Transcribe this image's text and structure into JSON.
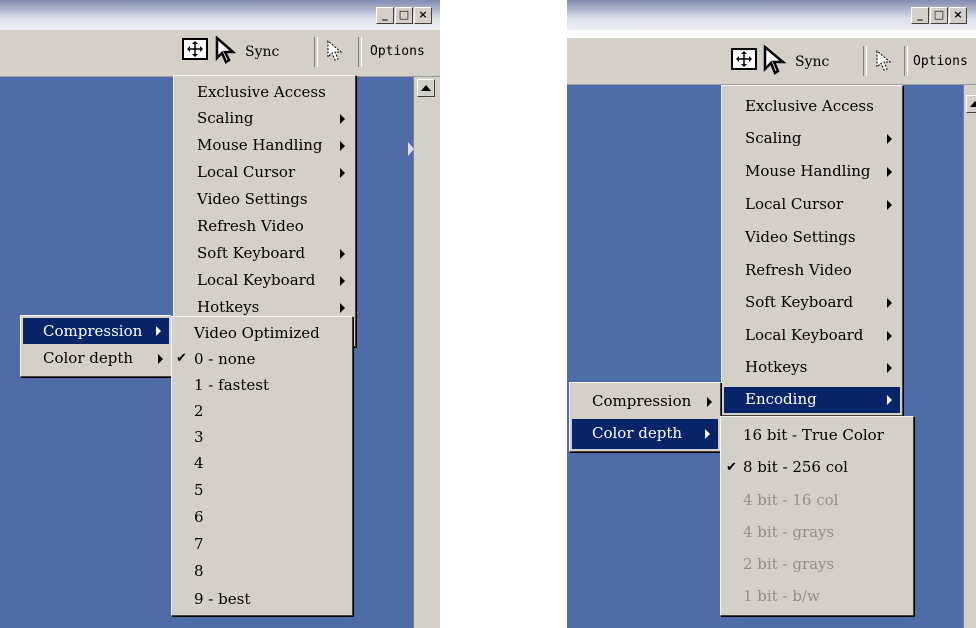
{
  "window_controls": {
    "minimize": "_",
    "maximize": "□",
    "close": "×"
  },
  "toolbar": {
    "sync_label": "Sync",
    "options_label": "Options"
  },
  "main_menu": [
    {
      "label": "Exclusive Access",
      "submenu": false
    },
    {
      "label": "Scaling",
      "submenu": true
    },
    {
      "label": "Mouse Handling",
      "submenu": true
    },
    {
      "label": "Local Cursor",
      "submenu": true
    },
    {
      "label": "Video Settings",
      "submenu": false
    },
    {
      "label": "Refresh Video",
      "submenu": false
    },
    {
      "label": "Soft Keyboard",
      "submenu": true
    },
    {
      "label": "Local Keyboard",
      "submenu": true
    },
    {
      "label": "Hotkeys",
      "submenu": true
    },
    {
      "label": "Encoding",
      "submenu": true
    }
  ],
  "encoding_menu": [
    {
      "label": "Compression",
      "submenu": true
    },
    {
      "label": "Color depth",
      "submenu": true
    }
  ],
  "compression_menu": [
    {
      "label": "Video Optimized",
      "checked": false
    },
    {
      "label": "0 - none",
      "checked": true
    },
    {
      "label": "1 - fastest",
      "checked": false
    },
    {
      "label": "2",
      "checked": false
    },
    {
      "label": "3",
      "checked": false
    },
    {
      "label": "4",
      "checked": false
    },
    {
      "label": "5",
      "checked": false
    },
    {
      "label": "6",
      "checked": false
    },
    {
      "label": "7",
      "checked": false
    },
    {
      "label": "8",
      "checked": false
    },
    {
      "label": "9 - best",
      "checked": false
    }
  ],
  "color_depth_menu": [
    {
      "label": "16 bit - True Color",
      "checked": false,
      "disabled": false
    },
    {
      "label": "8 bit - 256 col",
      "checked": true,
      "disabled": false
    },
    {
      "label": "4 bit - 16 col",
      "checked": false,
      "disabled": true
    },
    {
      "label": "4 bit - grays",
      "checked": false,
      "disabled": true
    },
    {
      "label": "2 bit - grays",
      "checked": false,
      "disabled": true
    },
    {
      "label": "1 bit - b/w",
      "checked": false,
      "disabled": true
    }
  ],
  "checkmark": "✔",
  "colors": {
    "desktop": "#4f6ca8",
    "menu": "#d4d0c8",
    "highlight": "#0a246a",
    "disabled_text": "#8e8e8e"
  },
  "icons": [
    "fit-screen-icon",
    "arrow-cursor-icon",
    "dotted-cursor-icon",
    "scroll-up-icon"
  ]
}
